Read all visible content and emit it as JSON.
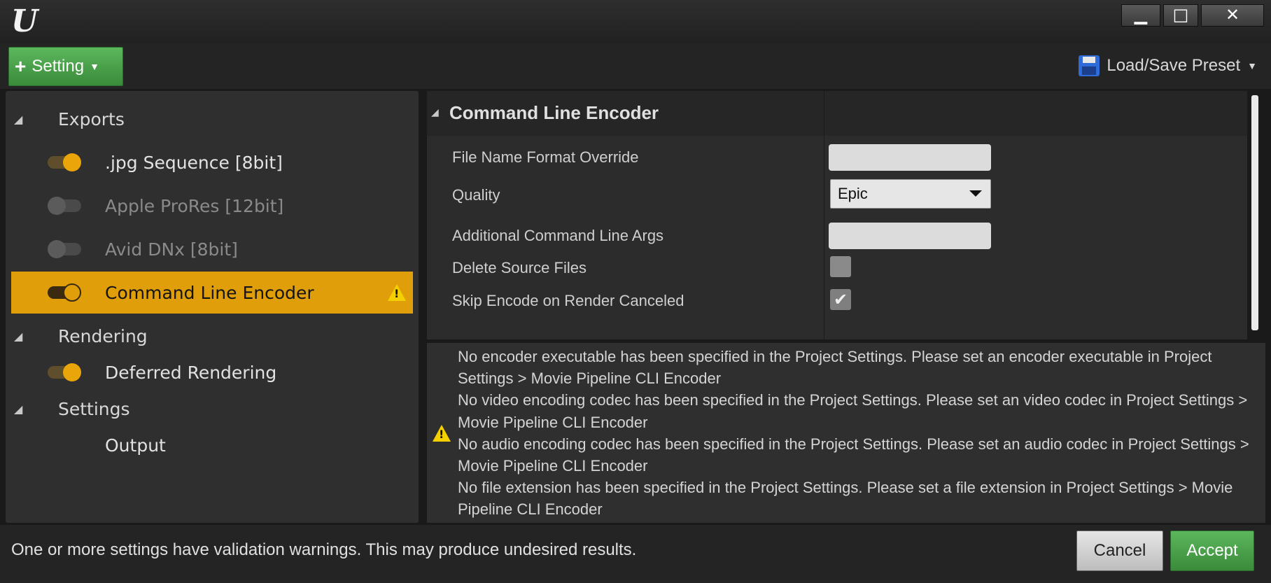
{
  "window": {
    "logo_icon": "unreal-logo-icon",
    "controls": {
      "minimize": "▁",
      "maximize": "□",
      "close": "✕"
    }
  },
  "toolbar": {
    "setting_label": "Setting",
    "preset_label": "Load/Save Preset"
  },
  "tree": {
    "exports_label": "Exports",
    "items": [
      {
        "label": ".jpg Sequence [8bit]",
        "enabled": true
      },
      {
        "label": "Apple ProRes [12bit]",
        "enabled": false
      },
      {
        "label": "Avid DNx [8bit]",
        "enabled": false
      },
      {
        "label": "Command Line Encoder",
        "enabled": true,
        "selected": true,
        "warning": true
      }
    ],
    "rendering_label": "Rendering",
    "rendering_item": {
      "label": "Deferred Rendering",
      "enabled": true
    },
    "settings_label": "Settings",
    "settings_item": {
      "label": "Output"
    }
  },
  "details": {
    "title": "Command Line Encoder",
    "properties": {
      "file_name_format_override": {
        "label": "File Name Format Override",
        "value": ""
      },
      "quality": {
        "label": "Quality",
        "value": "Epic"
      },
      "additional_args": {
        "label": "Additional Command Line Args",
        "value": ""
      },
      "delete_source_files": {
        "label": "Delete Source Files",
        "checked": false
      },
      "skip_encode": {
        "label": "Skip Encode on Render Canceled",
        "checked": true
      }
    }
  },
  "messages": [
    "No encoder executable has been specified in the Project Settings. Please set an encoder executable in Project Settings > Movie Pipeline CLI Encoder",
    "No video encoding codec has been specified in the Project Settings. Please set an video codec in Project Settings > Movie Pipeline CLI Encoder",
    "No audio encoding codec has been specified in the Project Settings. Please set an audio codec in Project Settings > Movie Pipeline CLI Encoder",
    "No file extension has been specified in the Project Settings. Please set a file extension in Project Settings > Movie Pipeline CLI Encoder"
  ],
  "footer": {
    "message": "One or more settings have validation warnings. This may produce undesired results.",
    "cancel_label": "Cancel",
    "accept_label": "Accept"
  },
  "colors": {
    "accent_orange": "#e09f0a",
    "accept_green": "#4cae4c",
    "warning_yellow": "#f5d000"
  }
}
